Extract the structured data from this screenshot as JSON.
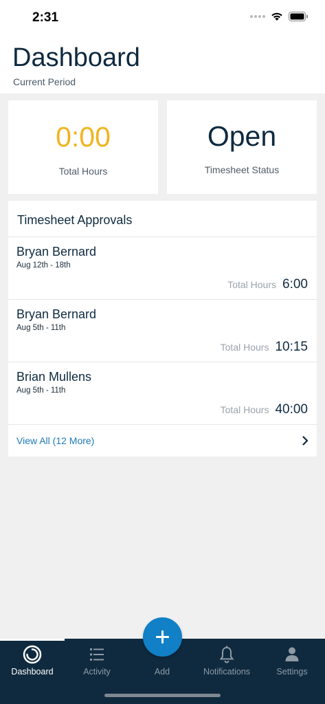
{
  "status_bar": {
    "time": "2:31"
  },
  "header": {
    "title": "Dashboard",
    "subtitle": "Current Period"
  },
  "stats": {
    "total_hours": {
      "value": "0:00",
      "label": "Total Hours",
      "color": "#f2b31e"
    },
    "timesheet_status": {
      "value": "Open",
      "label": "Timesheet Status"
    }
  },
  "approvals": {
    "title": "Timesheet Approvals",
    "rows": [
      {
        "name": "Bryan Bernard",
        "dates": "Aug 12th - 18th",
        "total_label": "Total Hours",
        "total": "6:00"
      },
      {
        "name": "Bryan Bernard",
        "dates": "Aug 5th - 11th",
        "total_label": "Total Hours",
        "total": "10:15"
      },
      {
        "name": "Brian Mullens",
        "dates": "Aug 5th - 11th",
        "total_label": "Total Hours",
        "total": "40:00"
      }
    ],
    "view_all": "View All (12 More)"
  },
  "nav": {
    "items": [
      {
        "label": "Dashboard",
        "icon": "dashboard-ring-icon",
        "active": true
      },
      {
        "label": "Activity",
        "icon": "list-icon"
      },
      {
        "label": "Add",
        "icon": "plus-icon"
      },
      {
        "label": "Notifications",
        "icon": "bell-icon"
      },
      {
        "label": "Settings",
        "icon": "person-icon"
      }
    ],
    "accent": "#1180c6",
    "background": "#0f2a3f"
  }
}
